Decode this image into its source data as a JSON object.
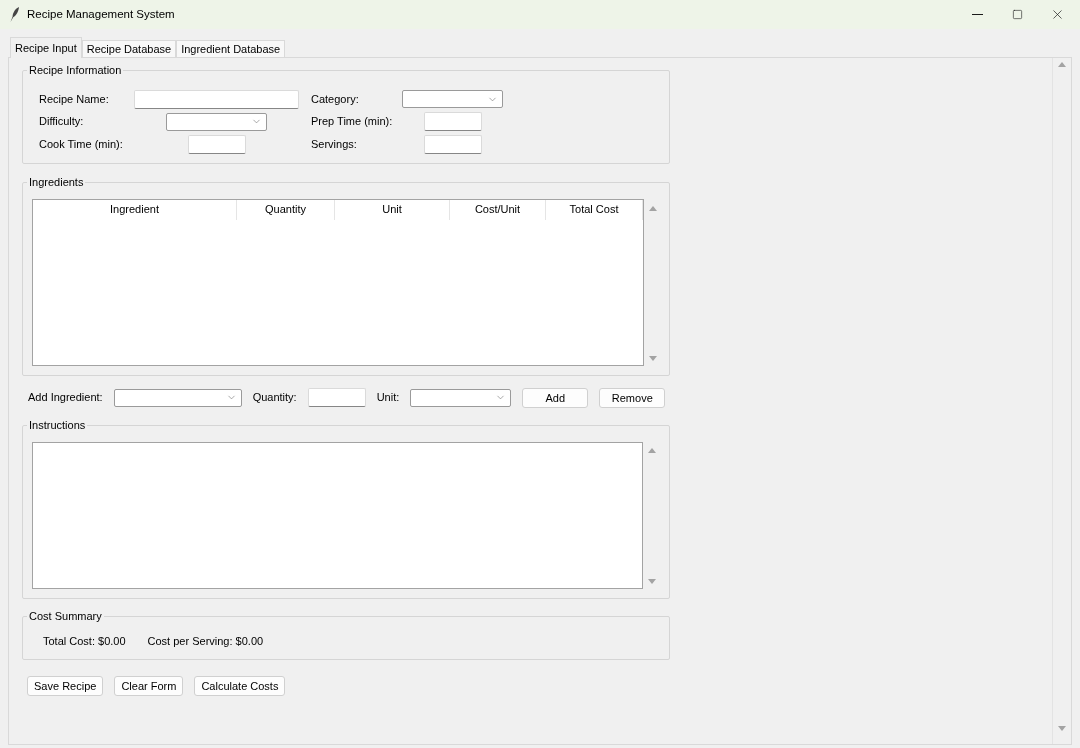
{
  "window": {
    "title": "Recipe Management System"
  },
  "tabs": [
    {
      "label": "Recipe Input",
      "selected": true
    },
    {
      "label": "Recipe Database",
      "selected": false
    },
    {
      "label": "Ingredient Database",
      "selected": false
    }
  ],
  "recipe_information": {
    "title": "Recipe Information",
    "fields": [
      {
        "label": "Recipe Name:",
        "kind": "text"
      },
      {
        "label": "Category:",
        "kind": "dropdown"
      },
      {
        "label": "Difficulty:",
        "kind": "dropdown"
      },
      {
        "label": "Prep Time (min):",
        "kind": "number"
      },
      {
        "label": "Cook Time (min):",
        "kind": "number"
      },
      {
        "label": "Servings:",
        "kind": "number"
      }
    ]
  },
  "ingredients": {
    "title": "Ingredients",
    "table": {
      "columns": [
        "Ingredient",
        "Quantity",
        "Unit",
        "Cost/Unit",
        "Total Cost"
      ]
    }
  },
  "add_ingredient": {
    "controls": [
      {
        "label": "Add Ingredient:",
        "kind": "dropdown"
      },
      {
        "label": "Quantity:",
        "kind": "number"
      },
      {
        "label": "Unit:",
        "kind": "dropdown"
      }
    ],
    "buttons": [
      "Add",
      "Remove"
    ]
  },
  "instructions": {
    "title": "Instructions"
  },
  "cost_summary": {
    "title": "Cost Summary",
    "items": [
      "Total Cost: $0.00",
      "Cost per Serving: $0.00"
    ]
  },
  "buttons": [
    "Save Recipe",
    "Clear Form",
    "Calculate Costs"
  ]
}
